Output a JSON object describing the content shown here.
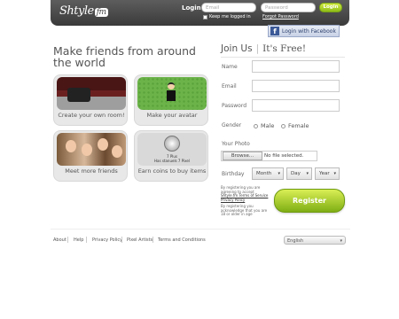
{
  "header": {
    "logo_main": "Shtyle",
    "logo_suffix": "fm",
    "login_label": "Login",
    "email_placeholder": "Email",
    "password_placeholder": "Password",
    "keep_logged_in": "Keep me logged in",
    "forgot_password": "Forgot Password",
    "login_button": "Login"
  },
  "facebook_login": "Login with Facebook",
  "headline": "Make friends from around the world",
  "tiles": [
    {
      "caption": "Create your own room!"
    },
    {
      "caption": "Make your avatar"
    },
    {
      "caption": "Meet more friends"
    },
    {
      "caption": "Earn coins to buy items",
      "image_text_top": "7 Plus",
      "image_text_bottom": "Has stanuels 7 Pixel"
    }
  ],
  "join": {
    "title": "Join Us",
    "subtitle": "It's Free!",
    "name_label": "Name",
    "email_label": "Email",
    "password_label": "Password",
    "gender_label": "Gender",
    "gender_male": "Male",
    "gender_female": "Female",
    "photo_label": "Your Photo",
    "browse_button": "Browse...",
    "file_status": "No file selected.",
    "birthday_label": "Birthday",
    "month": "Month",
    "day": "Day",
    "year": "Year",
    "terms_note_prefix": "By registering you are agreeing to accept",
    "terms_link": "Shtyle.fm Terms of Service",
    "privacy_link": "Privacy Policy",
    "age_note": "By registering you acknowledge that you are 18 or older in age",
    "register_button": "Register"
  },
  "footer": {
    "links": [
      "About",
      "Help",
      "Privacy Policy",
      "Pixel Artists",
      "Terms and Conditions"
    ],
    "language": "English"
  },
  "colors": {
    "accent_green": "#8ebc16",
    "header_dark": "#4a4a4a",
    "facebook_blue": "#3b5998"
  }
}
